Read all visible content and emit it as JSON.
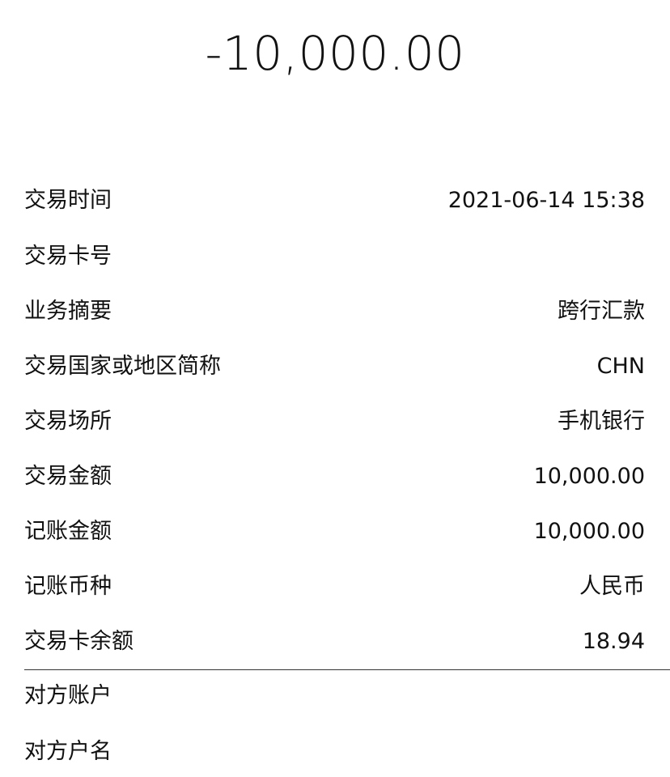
{
  "amount": "-10,000.00",
  "details": [
    {
      "label": "交易时间",
      "value": "2021-06-14 15:38"
    },
    {
      "label": "交易卡号",
      "value": ""
    },
    {
      "label": "业务摘要",
      "value": "跨行汇款"
    },
    {
      "label": "交易国家或地区简称",
      "value": "CHN"
    },
    {
      "label": "交易场所",
      "value": "手机银行"
    },
    {
      "label": "交易金额",
      "value": "10,000.00"
    },
    {
      "label": "记账金额",
      "value": "10,000.00"
    },
    {
      "label": "记账币种",
      "value": "人民币"
    },
    {
      "label": "交易卡余额",
      "value": "18.94"
    }
  ],
  "counterparty": [
    {
      "label": "对方账户",
      "value": ""
    },
    {
      "label": "对方户名",
      "value": ""
    }
  ]
}
